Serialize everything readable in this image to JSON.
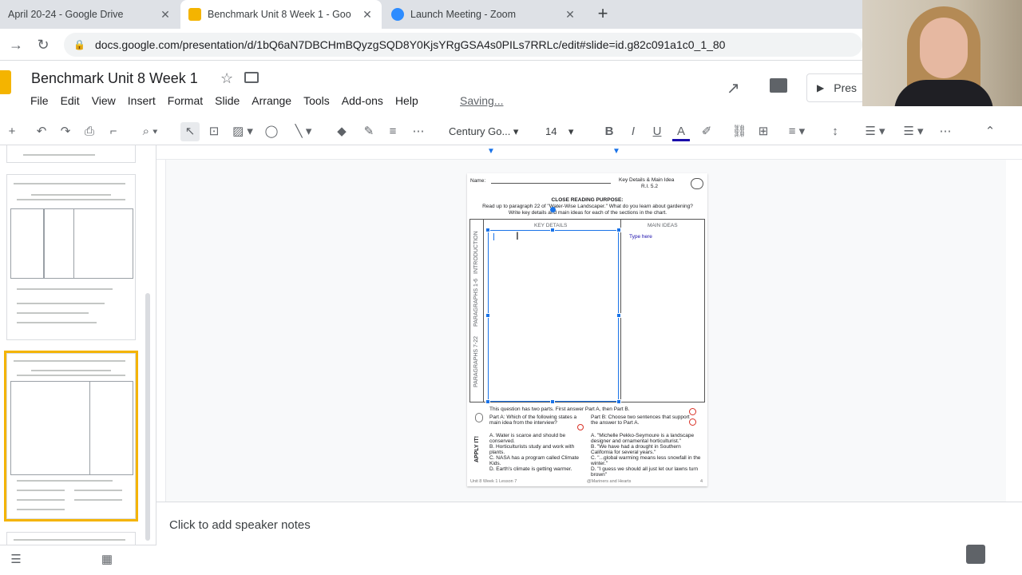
{
  "browser": {
    "tabs": [
      {
        "title": "April 20-24 - Google Drive",
        "favicon_color": "#34a853"
      },
      {
        "title": "Benchmark Unit 8 Week 1 - Goo",
        "favicon_color": "#f4b400"
      },
      {
        "title": "Launch Meeting - Zoom",
        "favicon_color": "#2d8cff"
      }
    ],
    "new_tab": "+",
    "url": "docs.google.com/presentation/d/1bQ6aN7DBCHmBQyzgSQD8Y0KjsYRgGSA4s0PILs7RRLc/edit#slide=id.g82c091a1c0_1_80"
  },
  "doc": {
    "title": "Benchmark Unit 8 Week 1",
    "menu": [
      "File",
      "Edit",
      "View",
      "Insert",
      "Format",
      "Slide",
      "Arrange",
      "Tools",
      "Add-ons",
      "Help"
    ],
    "saving": "Saving...",
    "present_label": "Pres"
  },
  "toolbar": {
    "font": "Century Go...",
    "size": "14"
  },
  "slide": {
    "name_label": "Name:",
    "header_right": "Key Details & Main Idea",
    "standard": "R.I. 5.2",
    "purpose_title": "CLOSE READING PURPOSE:",
    "purpose_text": "Read up to paragraph 22 of \"Water-Wise Landscaper.\" What do you learn about gardening? Write key details and main ideas for each of the sections in the chart.",
    "col_key": "KEY DETAILS",
    "col_main": "MAIN IDEAS",
    "type_here": "Type here",
    "rows": [
      "INTRODUCTION",
      "PARAGRAPHS 1-6",
      "PARAGRAPHS 7-22"
    ],
    "question_intro": "This question has two parts. First answer Part A, then Part B.",
    "part_a": "Part A: Which of the following states a main idea from the interview?",
    "part_b": "Part B: Choose two sentences that support the answer to Part A.",
    "a_opts": [
      "A. Water is scarce and should be conserved.",
      "B. Horticulturists study and work with plants.",
      "C. NASA has a program called Climate Kids.",
      "D. Earth's climate is getting warmer."
    ],
    "b_opts": [
      "A. \"Michelle Pekko-Seymoure is a landscape designer and ornamental horticulturist.\"",
      "B. \"We have had a drought in Southern California for several years.\"",
      "C. \"...global warming means less snowfall in the winter.\"",
      "D. \"I guess we should all just let our lawns turn brown\""
    ],
    "apply_it": "APPLY IT!",
    "footer_left": "Unit 8 Week 1 Lesson 7",
    "footer_mid": "@Mariners and Hearts",
    "page_no": "4"
  },
  "notes": {
    "placeholder": "Click to add speaker notes"
  },
  "colors": {
    "selection": "#1a73e8",
    "accent_yellow": "#f4b400"
  }
}
